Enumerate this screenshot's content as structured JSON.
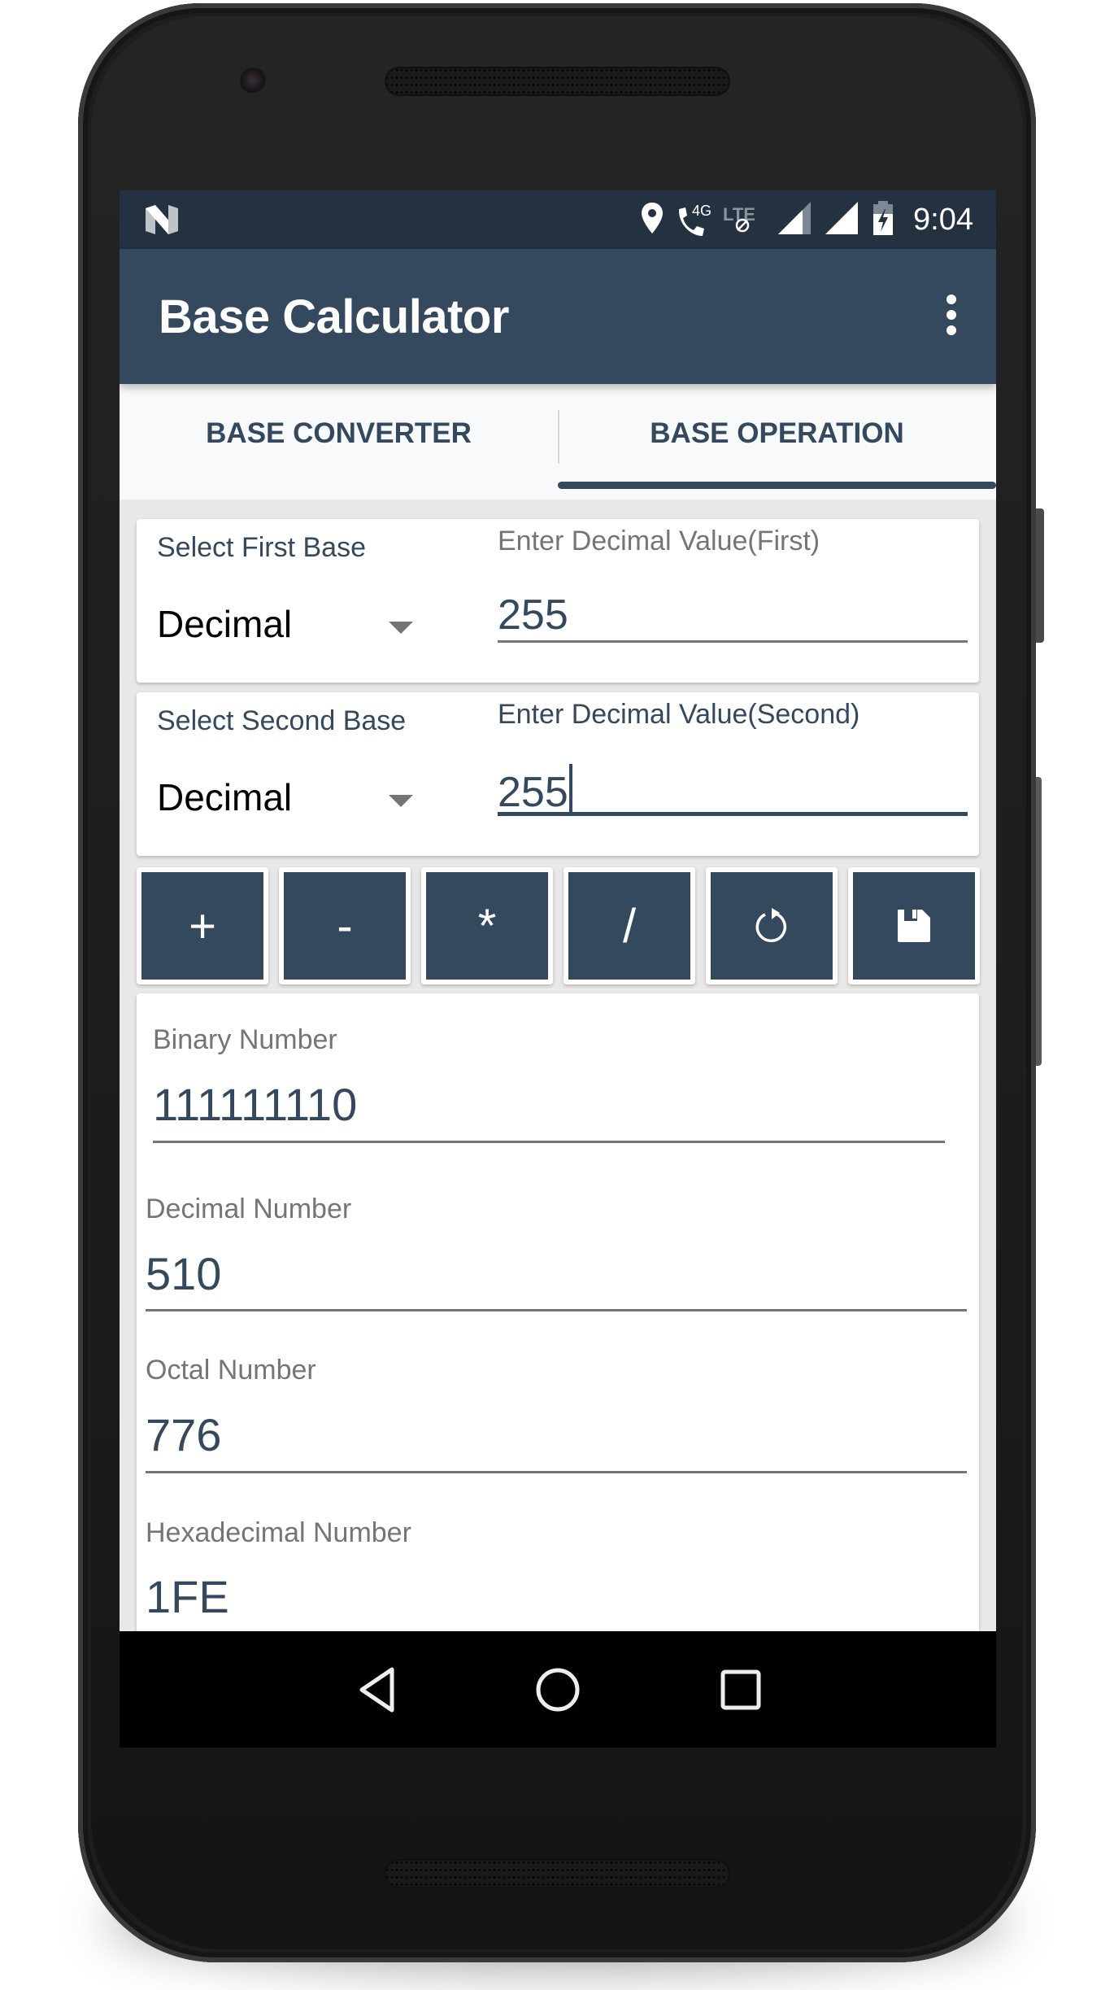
{
  "status_bar": {
    "notification_icon": "android-n-icon",
    "icons": [
      "location-icon",
      "wifi-calling-4g-icon",
      "lte-disabled-icon",
      "signal-icon",
      "signal-full-icon",
      "battery-charging-icon"
    ],
    "network_label": "4G",
    "lte_label": "LTE",
    "time": "9:04"
  },
  "app_bar": {
    "title": "Base Calculator",
    "overflow_icon": "more-vert-icon"
  },
  "tabs": [
    {
      "label": "BASE CONVERTER",
      "active": false
    },
    {
      "label": "BASE OPERATION",
      "active": true
    }
  ],
  "first_input": {
    "base_label": "Select First Base",
    "base_selected": "Decimal",
    "value_label": "Enter Decimal Value(First)",
    "value": "255"
  },
  "second_input": {
    "base_label": "Select Second Base",
    "base_selected": "Decimal",
    "value_label": "Enter Decimal Value(Second)",
    "value": "255"
  },
  "operations": [
    {
      "label": "+",
      "name": "add"
    },
    {
      "label": "-",
      "name": "subtract"
    },
    {
      "label": "*",
      "name": "multiply"
    },
    {
      "label": "/",
      "name": "divide"
    },
    {
      "label": "",
      "name": "reset",
      "icon": "refresh-icon"
    },
    {
      "label": "",
      "name": "save",
      "icon": "save-icon"
    }
  ],
  "results": [
    {
      "label": "Binary Number",
      "value": "111111110"
    },
    {
      "label": "Decimal Number",
      "value": "510"
    },
    {
      "label": "Octal Number",
      "value": "776"
    },
    {
      "label": "Hexadecimal Number",
      "value": "1FE"
    }
  ],
  "nav_bar": {
    "back": "back-icon",
    "home": "home-icon",
    "recents": "recents-icon"
  },
  "colors": {
    "primary": "#34495E",
    "primary_dark": "#233140",
    "tab_background": "#F8F9FA",
    "content_background": "#E8E8E8",
    "label_grey": "#757575"
  }
}
